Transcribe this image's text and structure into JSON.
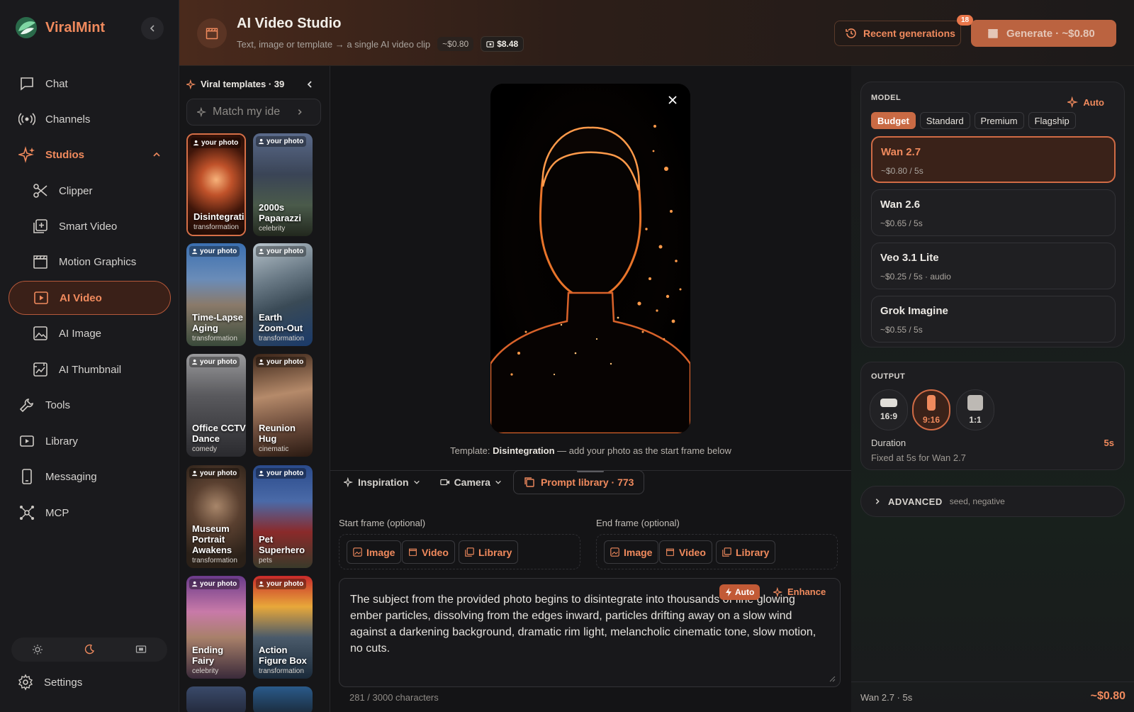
{
  "brand": {
    "name": "ViralMint"
  },
  "nav": {
    "items": [
      {
        "label": "Chat"
      },
      {
        "label": "Channels"
      },
      {
        "label": "Studios"
      },
      {
        "label": "Clipper"
      },
      {
        "label": "Smart Video"
      },
      {
        "label": "Motion Graphics"
      },
      {
        "label": "AI Video"
      },
      {
        "label": "AI Image"
      },
      {
        "label": "AI Thumbnail"
      },
      {
        "label": "Tools"
      },
      {
        "label": "Library"
      },
      {
        "label": "Messaging"
      },
      {
        "label": "MCP"
      }
    ],
    "settings": "Settings"
  },
  "header": {
    "title": "AI Video Studio",
    "subtitle": "Text, image or template → a single AI video clip",
    "cost": "~$0.80",
    "balance": "$8.48",
    "recent_label": "Recent generations",
    "recent_count": "18",
    "generate_label": "Generate · ~$0.80"
  },
  "templates": {
    "heading": "Viral templates · 39",
    "match_placeholder": "Match my ide",
    "tag": "your photo",
    "cards": [
      {
        "name": "Disintegrati",
        "category": "transformation"
      },
      {
        "name": "2000s Paparazzi",
        "category": "celebrity"
      },
      {
        "name": "Time-Lapse Aging",
        "category": "transformation"
      },
      {
        "name": "Earth Zoom-Out",
        "category": "transformation"
      },
      {
        "name": "Office CCTV Dance",
        "category": "comedy"
      },
      {
        "name": "Reunion Hug",
        "category": "cinematic"
      },
      {
        "name": "Museum Portrait Awakens",
        "category": "transformation"
      },
      {
        "name": "Pet Superhero",
        "category": "pets"
      },
      {
        "name": "Ending Fairy",
        "category": "celebrity"
      },
      {
        "name": "Action Figure Box",
        "category": "transformation"
      }
    ]
  },
  "preview": {
    "caption_prefix": "Template:",
    "caption_name": "Disintegration",
    "caption_suffix": "— add your photo as the start frame below"
  },
  "controls": {
    "inspiration": "Inspiration",
    "camera": "Camera",
    "prompt_library": "Prompt library · 773",
    "start_frame": "Start frame (optional)",
    "end_frame": "End frame (optional)",
    "image": "Image",
    "video": "Video",
    "library": "Library",
    "auto": "Auto",
    "enhance": "Enhance",
    "prompt": "The subject from the provided photo begins to disintegrate into thousands of fine glowing ember particles, dissolving from the edges inward, particles drifting away on a slow wind against a darkening background, dramatic rim light, melancholic cinematic tone, slow motion, no cuts.",
    "char_count": "281 / 3000 characters"
  },
  "model_panel": {
    "label": "MODEL",
    "auto": "Auto",
    "tiers": [
      "Budget",
      "Standard",
      "Premium",
      "Flagship"
    ],
    "models": [
      {
        "name": "Wan 2.7",
        "price": "~$0.80 / 5s"
      },
      {
        "name": "Wan 2.6",
        "price": "~$0.65 / 5s"
      },
      {
        "name": "Veo 3.1 Lite",
        "price": "~$0.25 / 5s · audio"
      },
      {
        "name": "Grok Imagine",
        "price": "~$0.55 / 5s"
      }
    ]
  },
  "output": {
    "label": "OUTPUT",
    "ratios": [
      "16:9",
      "9:16",
      "1:1"
    ],
    "duration_label": "Duration",
    "duration_value": "5s",
    "duration_note": "Fixed at 5s for Wan 2.7"
  },
  "advanced": {
    "label": "ADVANCED",
    "sub": "seed, negative"
  },
  "footer": {
    "summary": "Wan 2.7 · 5s",
    "cost": "~$0.80"
  },
  "colors": {
    "accent": "#f08a5d",
    "accent_strong": "#c96a44",
    "background": "#141416"
  }
}
